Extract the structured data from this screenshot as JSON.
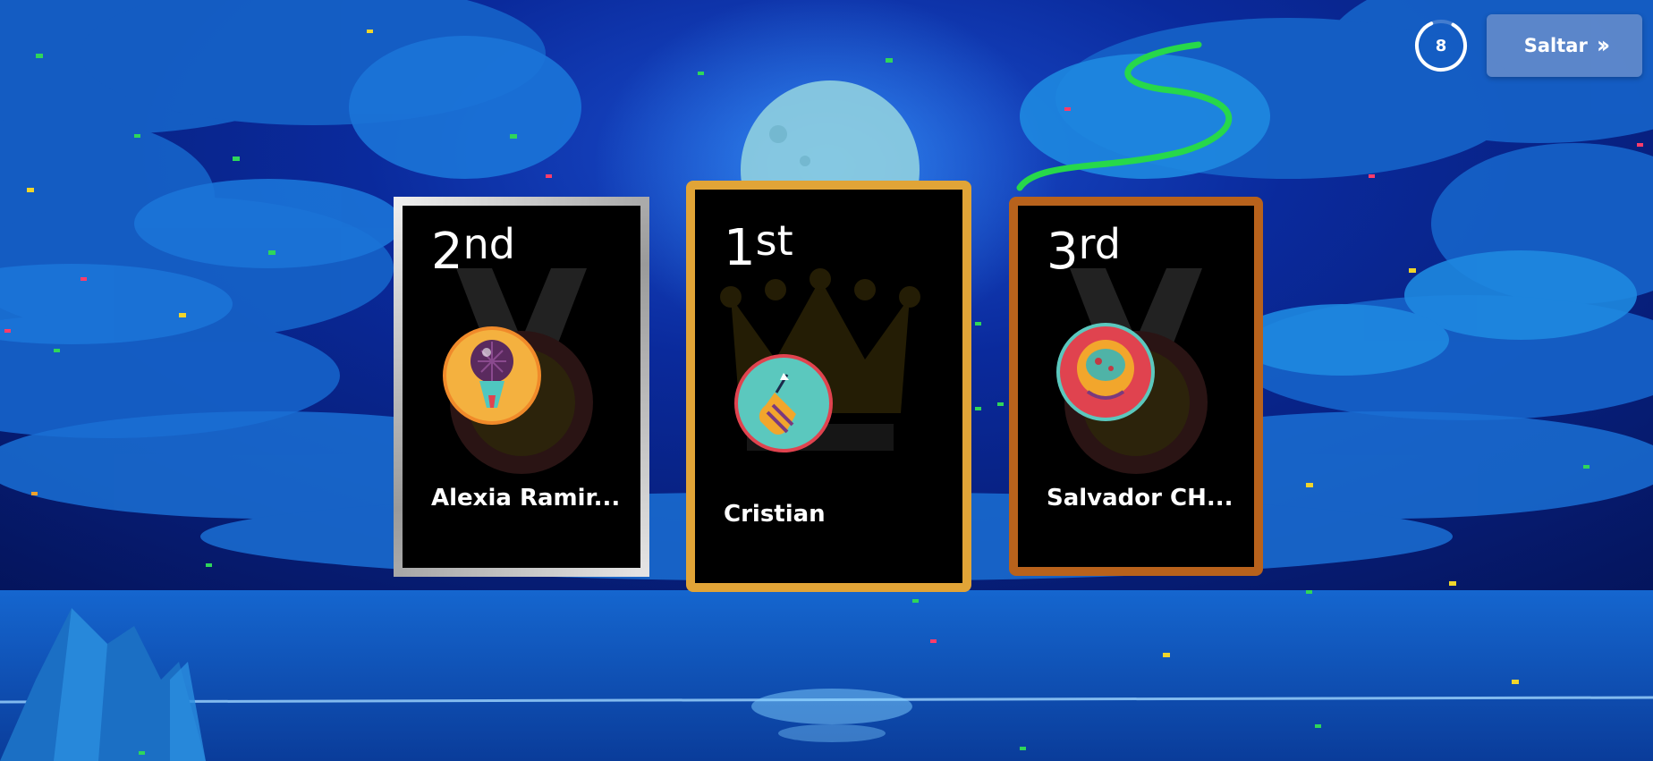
{
  "timer": {
    "value": "8",
    "progress": 0.85
  },
  "skip_button": {
    "label": "Saltar",
    "icon": "double-chevron-right-icon"
  },
  "podium": [
    {
      "place": "2",
      "suffix": "nd",
      "name": "Alexia Ramir...",
      "avatar": "microphone-avatar",
      "frame_color": "#b9b9b9"
    },
    {
      "place": "1",
      "suffix": "st",
      "name": "Cristian",
      "avatar": "firework-rocket-avatar",
      "frame_color": "#e1a437"
    },
    {
      "place": "3",
      "suffix": "rd",
      "name": "Salvador CH...",
      "avatar": "astronaut-helmet-avatar",
      "frame_color": "#b8621c"
    }
  ],
  "colors": {
    "sky": "#071a6e",
    "sea": "#0c4fb3",
    "moon": "#8fcfe0"
  }
}
